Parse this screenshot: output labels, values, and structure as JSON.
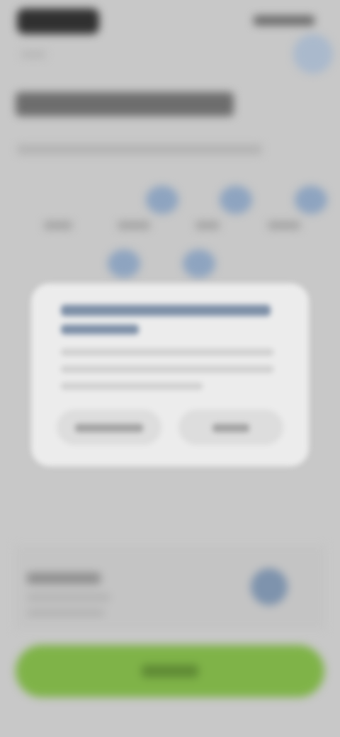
{
  "status_bar": {
    "time": "",
    "icons": ""
  },
  "header": {
    "back_label": "",
    "title": "",
    "subtitle": ""
  },
  "options": [
    {
      "label": ""
    },
    {
      "label": ""
    },
    {
      "label": ""
    },
    {
      "label": ""
    },
    {
      "label": ""
    },
    {
      "label": ""
    },
    {
      "label": ""
    }
  ],
  "dialog": {
    "title_line_1": "",
    "title_line_2": "",
    "body_lines": [
      "",
      "",
      ""
    ],
    "cancel_label": "",
    "confirm_label": ""
  },
  "settings": {
    "label": "",
    "description_1": "",
    "description_2": ""
  },
  "primary_button": {
    "label": ""
  },
  "colors": {
    "background": "#c8c8c8",
    "dialog": "#ececec",
    "accent_blue": "#7d8fa7",
    "primary_green": "#7fb348"
  }
}
